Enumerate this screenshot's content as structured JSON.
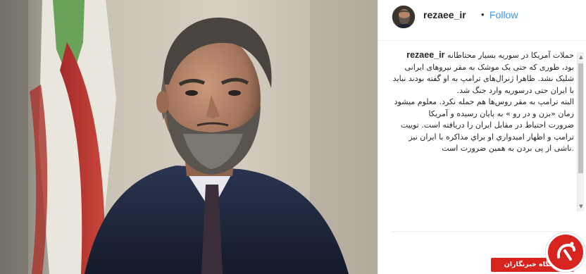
{
  "post": {
    "username": "rezaee_ir",
    "separator": "•",
    "follow_label": "Follow",
    "caption": {
      "username": "rezaee_ir",
      "first_line": "حملات آمریکا در سوریه بسیار محتاطانه",
      "lines": [
        "بود، طوری که حتی یک موشک به مقر نیروهای ایرانی",
        "شلیک نشد. ظاهرا ژنرال‌های ترامپ به او گفته بودند نباید",
        "با ایران حتی درسوریه وارد جنگ شد.",
        "البته ترامپ به مقر روس‌ها هم حمله نکرد. معلوم میشود",
        "زمان «بزن و در رو » به پایان رسیده و آمریکا",
        "ضرورت احتیاط در مقابل ایران را دریافته است. توییت",
        "ترامپ و اظهار امیدواري او براي مذاکره با ایران نیز",
        ".ناشی از پی بردن به همین ضرورت است"
      ]
    }
  },
  "watermark": {
    "label": "باشگاه خبرنگاران",
    "brand_color": "#d8241f"
  },
  "colors": {
    "follow": "#3897f0",
    "text": "#262626",
    "border": "#efefef"
  },
  "icons": {
    "avatar": "profile-photo",
    "scroll_up": "scroll-up-arrow-icon",
    "scroll_down": "scroll-down-arrow-icon",
    "logo": "yjc-logo-icon"
  }
}
